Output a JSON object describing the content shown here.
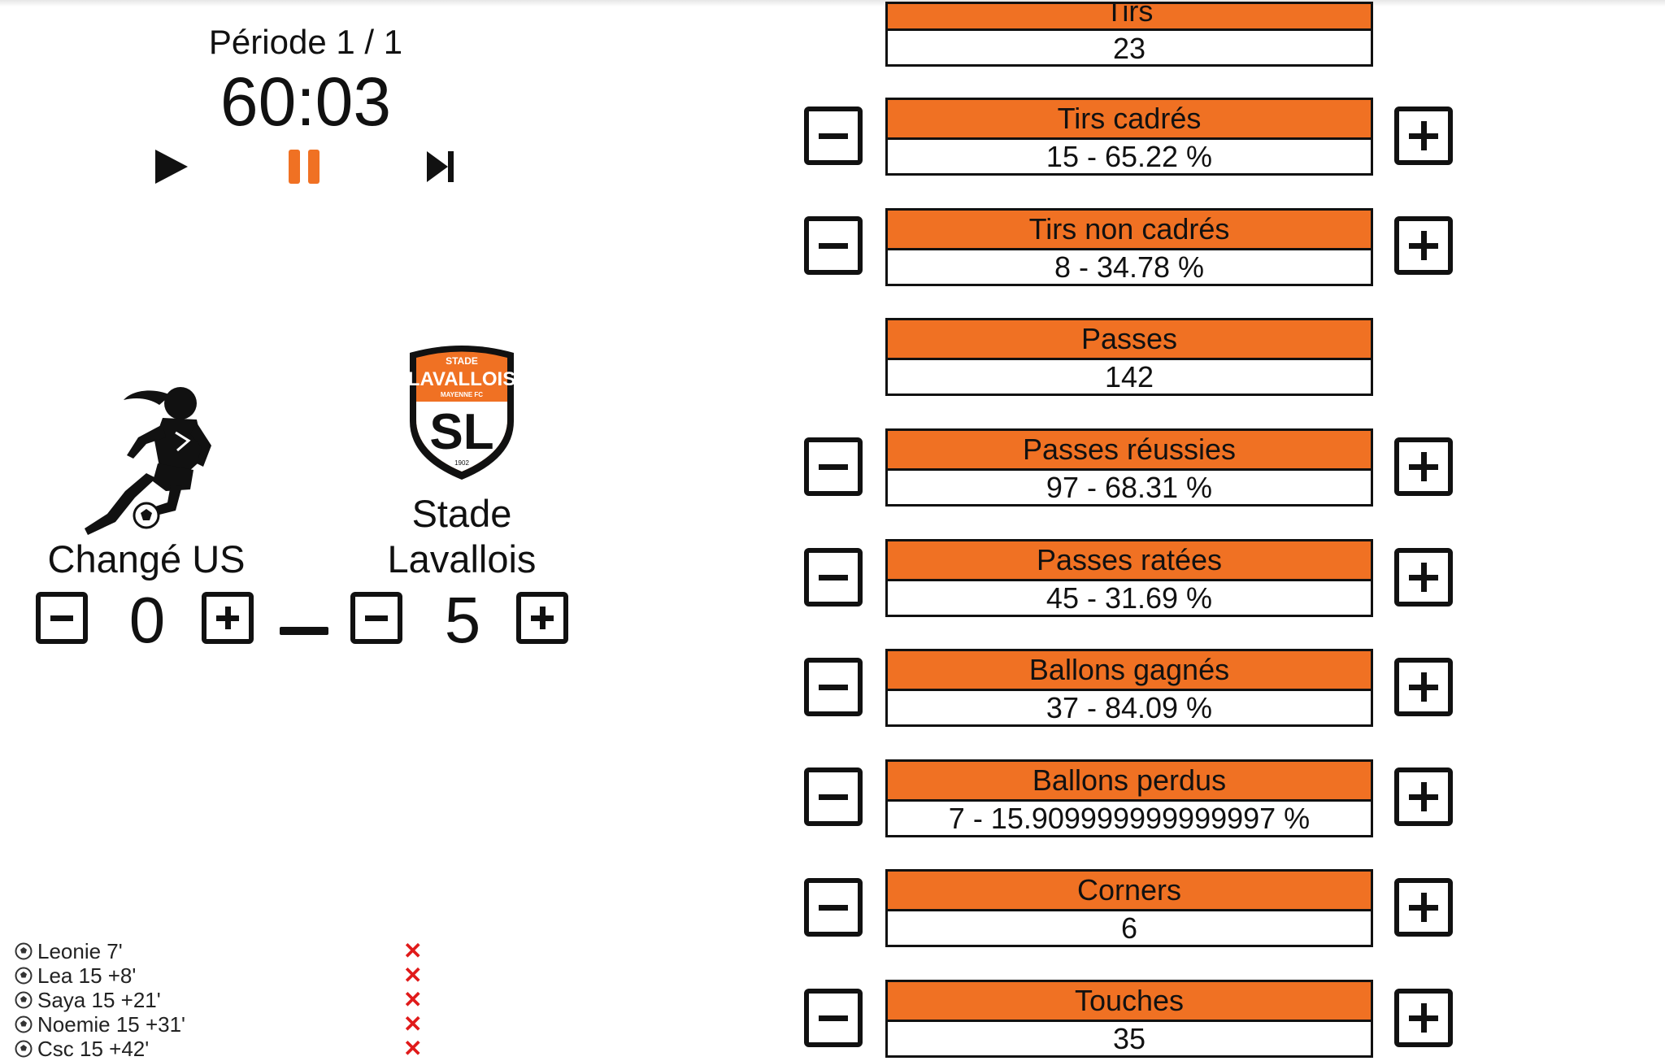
{
  "match": {
    "period": "Période 1 / 1",
    "clock": "60:03"
  },
  "controls": {
    "play_icon": "play-icon",
    "pause_icon": "pause-icon",
    "skip_icon": "skip-next-icon",
    "pause_color": "#f07123"
  },
  "home": {
    "name": "Changé US",
    "score": "0",
    "logo_icon": "female-football-player-icon"
  },
  "away": {
    "name_line1": "Stade",
    "name_line2": "Lavallois",
    "score": "5",
    "logo": {
      "top": "STADE",
      "main": "LAVALLOIS",
      "sub": "MAYENNE FC",
      "mono": "SL",
      "year": "1902"
    }
  },
  "events": [
    {
      "label": "Leonie 7'"
    },
    {
      "label": "Lea 15 +8'"
    },
    {
      "label": "Saya 15 +21'"
    },
    {
      "label": "Noemie 15 +31'"
    },
    {
      "label": "Csc 15 +42'"
    }
  ],
  "stats": {
    "tirs": {
      "title": "Tirs",
      "value": "23"
    },
    "tirs_cadres": {
      "title": "Tirs cadrés",
      "value": "15 - 65.22 %"
    },
    "tirs_non": {
      "title": "Tirs non cadrés",
      "value": "8 - 34.78 %"
    },
    "passes": {
      "title": "Passes",
      "value": "142"
    },
    "passes_reuss": {
      "title": "Passes réussies",
      "value": "97 - 68.31 %"
    },
    "passes_rat": {
      "title": "Passes ratées",
      "value": "45 - 31.69 %"
    },
    "ballons_g": {
      "title": "Ballons gagnés",
      "value": "37 - 84.09 %"
    },
    "ballons_p": {
      "title": "Ballons perdus",
      "value": "7 - 15.909999999999997 %"
    },
    "corners": {
      "title": "Corners",
      "value": "6"
    },
    "touches": {
      "title": "Touches",
      "value": "35"
    }
  },
  "colors": {
    "accent": "#f07123",
    "delete": "#e01a1a"
  }
}
